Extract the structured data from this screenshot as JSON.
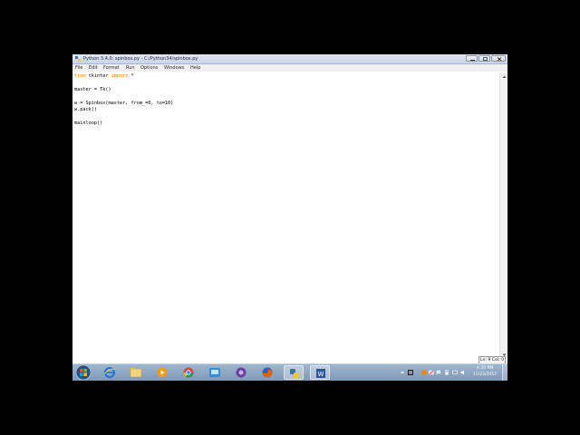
{
  "window": {
    "title": "Python 3.4.0: spinbox.py - C:/Python34/spinbox.py"
  },
  "menu": [
    {
      "label": "File"
    },
    {
      "label": "Edit"
    },
    {
      "label": "Format"
    },
    {
      "label": "Run"
    },
    {
      "label": "Options"
    },
    {
      "label": "Windows"
    },
    {
      "label": "Help"
    }
  ],
  "code": {
    "line1_kw1": "from",
    "line1_mid": " tkinter ",
    "line1_kw2": "import",
    "line1_end": " *",
    "line2": "master = Tk()",
    "line3": "w = Spinbox(master, from_=0, to=10)",
    "line4": "w.pack()",
    "line5": "mainloop()"
  },
  "status": {
    "position": "Ln: 9 Col: 0"
  },
  "taskbar": {
    "apps": [
      "start-orb",
      "internet-explorer",
      "file-explorer",
      "media-player",
      "chrome",
      "remote-desktop",
      "media-center",
      "firefox",
      "python-idle",
      "word"
    ],
    "clock_time": "4:35 PM",
    "clock_date": "11/22/2017"
  },
  "colors": {
    "keyword": "#ff7700",
    "taskbar": "#8aa3c0",
    "background": "#000000"
  }
}
